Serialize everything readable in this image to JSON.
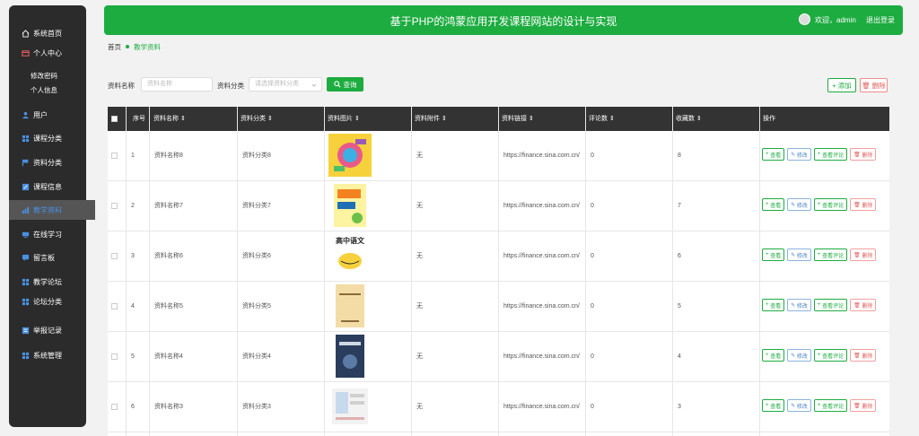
{
  "header": {
    "title": "基于PHP的鸿蒙应用开发课程网站的设计与实现",
    "welcome": "欢迎，admin",
    "logout": "退出登录"
  },
  "sidebar": {
    "items": [
      {
        "label": "系统首页",
        "icon": "home-icon"
      },
      {
        "label": "个人中心",
        "icon": "card-icon"
      },
      {
        "label": "用户",
        "icon": "user-icon"
      },
      {
        "label": "课程分类",
        "icon": "grid-icon"
      },
      {
        "label": "资料分类",
        "icon": "flag-icon"
      },
      {
        "label": "课程信息",
        "icon": "edit-icon"
      },
      {
        "label": "教学资料",
        "icon": "chart-icon"
      },
      {
        "label": "在线学习",
        "icon": "screen-icon"
      },
      {
        "label": "留言板",
        "icon": "chat-icon"
      },
      {
        "label": "教学论坛",
        "icon": "grid-icon"
      },
      {
        "label": "论坛分类",
        "icon": "grid-icon"
      },
      {
        "label": "举报记录",
        "icon": "list-icon"
      },
      {
        "label": "系统管理",
        "icon": "grid-icon"
      }
    ],
    "subitems": [
      "修改密码",
      "个人信息"
    ]
  },
  "breadcrumb": {
    "home": "首页",
    "current": "教学资料"
  },
  "filter": {
    "name_label": "资料名称",
    "name_placeholder": "资料名称",
    "category_label": "资料分类",
    "category_placeholder": "请选择资料分类",
    "query_label": "查询"
  },
  "actions": {
    "add": "添加",
    "delete": "删除"
  },
  "table": {
    "headers": [
      "序号",
      "资料名称",
      "资料分类",
      "资料图片",
      "资料附件",
      "资料链接",
      "评论数",
      "收藏数",
      "操作"
    ],
    "rows": [
      {
        "idx": "1",
        "name": "资料名称8",
        "cat": "资料分类8",
        "att": "无",
        "link": "https://finance.sina.com.cn/",
        "comments": "0",
        "fav": "8"
      },
      {
        "idx": "2",
        "name": "资料名称7",
        "cat": "资料分类7",
        "att": "无",
        "link": "https://finance.sina.com.cn/",
        "comments": "0",
        "fav": "7"
      },
      {
        "idx": "3",
        "name": "资料名称6",
        "cat": "资料分类6",
        "att": "无",
        "link": "https://finance.sina.com.cn/",
        "comments": "0",
        "fav": "6"
      },
      {
        "idx": "4",
        "name": "资料名称5",
        "cat": "资料分类5",
        "att": "无",
        "link": "https://finance.sina.com.cn/",
        "comments": "0",
        "fav": "5"
      },
      {
        "idx": "5",
        "name": "资料名称4",
        "cat": "资料分类4",
        "att": "无",
        "link": "https://finance.sina.com.cn/",
        "comments": "0",
        "fav": "4"
      },
      {
        "idx": "6",
        "name": "资料名称3",
        "cat": "资料分类3",
        "att": "无",
        "link": "https://finance.sina.com.cn/",
        "comments": "0",
        "fav": "3"
      }
    ],
    "ops": {
      "view": "查看",
      "edit": "修改",
      "view_comments": "查看评论",
      "delete": "删除"
    },
    "img3_text": "高中语文"
  },
  "colors": {
    "accent": "#1dac40",
    "danger": "#e05a5a",
    "sidebar": "#2b2b2b"
  }
}
